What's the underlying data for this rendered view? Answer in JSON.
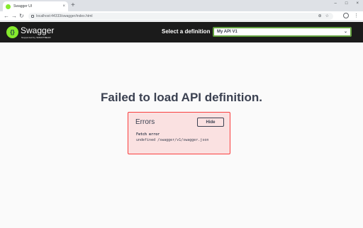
{
  "browser": {
    "tab_title": "Swagger UI",
    "tab_close": "×",
    "new_tab": "+",
    "address": "localhost:44333/swagger/index.html",
    "back": "←",
    "forward": "→",
    "reload": "↻",
    "window_min": "–",
    "window_max": "□",
    "window_close": "×",
    "zoom_icon": "⊕",
    "star_icon": "☆",
    "menu_icon": "⋮"
  },
  "header": {
    "brand": "Swagger",
    "brand_sub": "Supported by SMARTBEAR",
    "logo_glyph": "{}",
    "select_label": "Select a definition",
    "selected_definition": "My API V1",
    "chevron": "⌄"
  },
  "main": {
    "title": "Failed to load API definition."
  },
  "errors": {
    "heading": "Errors",
    "hide_label": "Hide",
    "type": "Fetch error",
    "detail": "undefined /swagger/v1/swagger.json"
  },
  "colors": {
    "accent": "#85ea2d",
    "error_border": "#f93e3e",
    "error_bg": "#fae1e1",
    "topbar": "#1b1b1b"
  }
}
